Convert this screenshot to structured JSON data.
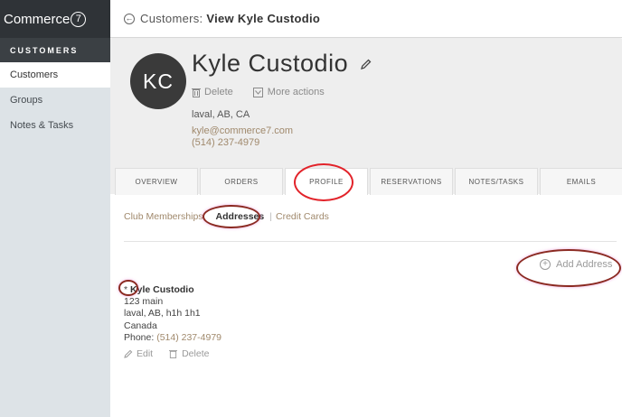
{
  "sidebar": {
    "logo_text": "Commerce",
    "logo_number": "7",
    "section_heading": "CUSTOMERS",
    "items": [
      {
        "label": "Customers",
        "active": true
      },
      {
        "label": "Groups",
        "active": false
      },
      {
        "label": "Notes & Tasks",
        "active": false
      }
    ]
  },
  "header": {
    "prefix": "Customers: ",
    "title": "View Kyle Custodio"
  },
  "profile": {
    "initials": "KC",
    "name": "Kyle Custodio",
    "delete_label": "Delete",
    "more_actions_label": "More actions",
    "location": "laval, AB, CA",
    "email": "kyle@commerce7.com",
    "phone": "(514) 237-4979"
  },
  "tabs": [
    {
      "label": "OVERVIEW"
    },
    {
      "label": "ORDERS"
    },
    {
      "label": "PROFILE",
      "active": true
    },
    {
      "label": "RESERVATIONS"
    },
    {
      "label": "NOTES/TASKS"
    },
    {
      "label": "EMAILS"
    }
  ],
  "subnav": {
    "club_memberships": "Club Memberships",
    "addresses": "Addresses",
    "credit_cards": "Credit Cards",
    "separator": "|"
  },
  "add_address_label": "Add Address",
  "address": {
    "default_marker": "*",
    "name": "Kyle Custodio",
    "line1": "123 main",
    "line2": "laval, AB, h1h 1h1",
    "country": "Canada",
    "phone_label": "Phone: ",
    "phone": "(514) 237-4979",
    "edit_label": "Edit",
    "delete_label": "Delete"
  },
  "colors": {
    "sidebar_dark": "#2f3337",
    "sidebar_bg": "#dde3e7",
    "link_accent": "#a0896c",
    "annotation_red": "#e2232a",
    "annotation_maroon": "#8b2a22"
  }
}
